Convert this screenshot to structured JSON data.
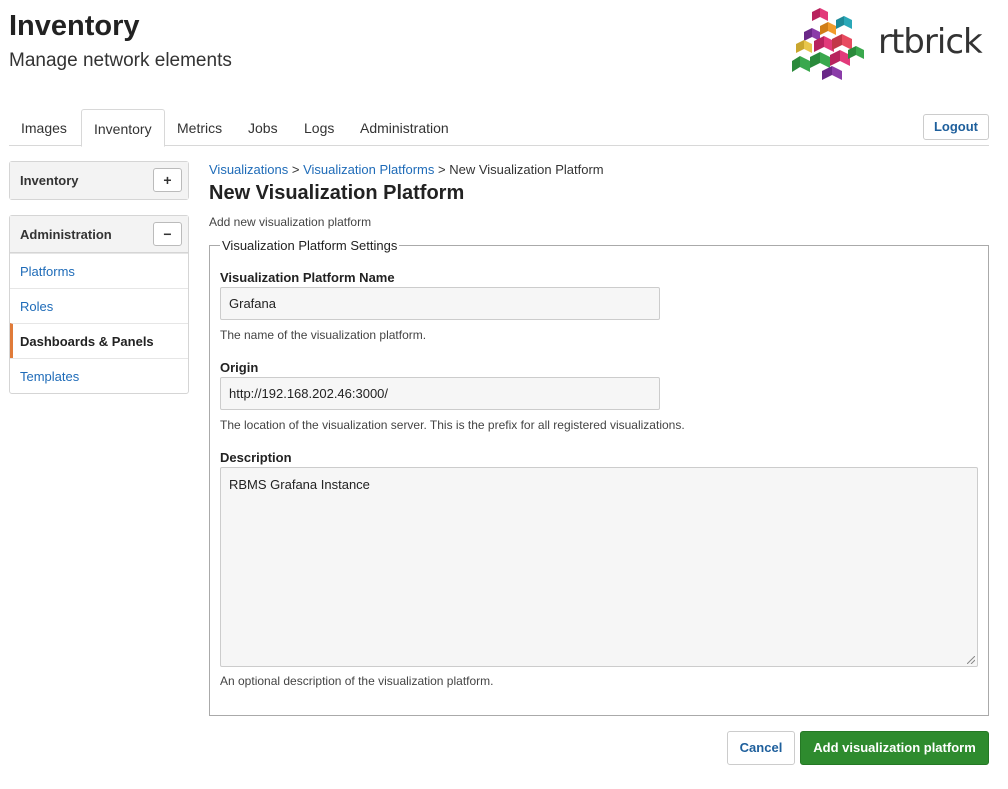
{
  "header": {
    "title": "Inventory",
    "subtitle": "Manage network elements"
  },
  "logo": {
    "text": "rtbrick",
    "colors": [
      "#e23a7a",
      "#f29b2b",
      "#3aa84d",
      "#2aa8b8",
      "#8a3ca8"
    ]
  },
  "tabs": [
    {
      "label": "Images",
      "active": false
    },
    {
      "label": "Inventory",
      "active": true
    },
    {
      "label": "Metrics",
      "active": false
    },
    {
      "label": "Jobs",
      "active": false
    },
    {
      "label": "Logs",
      "active": false
    },
    {
      "label": "Administration",
      "active": false
    }
  ],
  "logout_label": "Logout",
  "sidebar": {
    "inventory_panel": {
      "title": "Inventory",
      "toggle": "+"
    },
    "admin_panel": {
      "title": "Administration",
      "toggle": "−",
      "items": [
        {
          "label": "Platforms",
          "active": false
        },
        {
          "label": "Roles",
          "active": false
        },
        {
          "label": "Dashboards & Panels",
          "active": true
        },
        {
          "label": "Templates",
          "active": false
        }
      ]
    }
  },
  "breadcrumb": {
    "items": [
      "Visualizations",
      "Visualization Platforms"
    ],
    "separator": ">",
    "current": "New Visualization Platform"
  },
  "page": {
    "title": "New Visualization Platform",
    "description": "Add new visualization platform"
  },
  "form": {
    "legend": "Visualization Platform Settings",
    "name": {
      "label": "Visualization Platform Name",
      "value": "Grafana",
      "help": "The name of the visualization platform."
    },
    "origin": {
      "label": "Origin",
      "value": "http://192.168.202.46:3000/",
      "help": "The location of the visualization server. This is the prefix for all registered visualizations."
    },
    "description": {
      "label": "Description",
      "value": "RBMS Grafana Instance",
      "help": "An optional description of the visualization platform."
    }
  },
  "actions": {
    "cancel_label": "Cancel",
    "submit_label": "Add visualization platform"
  },
  "colors": {
    "link": "#1e6bb8",
    "primary": "#2e8b2e",
    "active_marker": "#e07b39"
  }
}
